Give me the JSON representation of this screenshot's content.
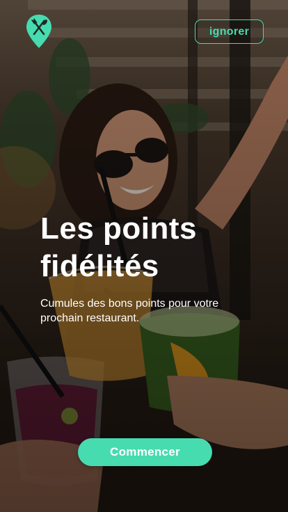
{
  "brand": {
    "logo_icon": "fork-knife-pin-icon",
    "accent_color": "#47dbb0"
  },
  "header": {
    "skip_label": "ignorer"
  },
  "onboarding": {
    "title": "Les points fidélités",
    "subtitle": "Cumules des bons points pour votre prochain restaurant.",
    "cta_label": "Commencer"
  }
}
